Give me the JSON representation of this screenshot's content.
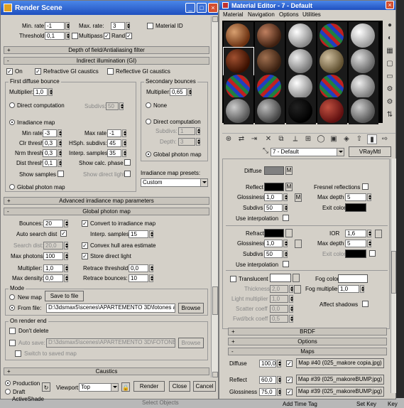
{
  "render_scene": {
    "title": "Render Scene",
    "top": {
      "min_rate_label": "Min. rate:",
      "min_rate": "-1",
      "max_rate_label": "Max. rate:",
      "max_rate": "3",
      "threshold_label": "Threshold:",
      "threshold": "0,1",
      "multipass_label": "Multipass",
      "rand_label": "Rand",
      "material_id_label": "Material ID"
    },
    "rollouts": {
      "dof": "Depth of field/Antialiasing filter",
      "indirect": "Indirect illumination (GI)",
      "adv_irr": "Advanced irradiance map parameters",
      "global_photon": "Global photon map",
      "caustics": "Caustics"
    },
    "gi": {
      "on_label": "On",
      "refr_label": "Refractive GI caustics",
      "refl_label": "Reflective GI caustics",
      "first_bounce": "First diffuse bounce",
      "multiplier_label": "Multiplier:",
      "multiplier": "1,0",
      "direct_comp": "Direct computation",
      "subdivs_label": "Subdivs:",
      "subdivs": "50",
      "irr_map": "Irradiance map",
      "min_rate_label": "Min rate:",
      "min_rate": "-3",
      "max_rate_label": "Max rate:",
      "max_rate": "-1",
      "clr_label": "Clr thresh:",
      "clr": "0,3",
      "hsph_label": "HSph. subdivs:",
      "hsph": "45",
      "nrm_label": "Nrm thresh:",
      "nrm": "0,3",
      "interp_label": "Interp. samples:",
      "interp": "35",
      "dist_label": "Dist thresh:",
      "dist": "0,1",
      "show_calc": "Show calc. phase",
      "show_samples": "Show samples",
      "show_direct": "Show direct light",
      "gpm": "Global photon map",
      "second_bounce": "Secondary bounces",
      "mult2_label": "Multiplier:",
      "mult2": "0,65",
      "none": "None",
      "direct2": "Direct computation",
      "subdivs2_label": "Subdivs:",
      "subdivs2": "1",
      "depth_label": "Depth:",
      "depth": "3",
      "gpm2": "Global photon map",
      "presets_label": "Irradiance map presets:",
      "preset": "Custom"
    },
    "gpm": {
      "bounces_label": "Bounces:",
      "bounces": "20",
      "convert": "Convert to irradiance map",
      "auto_search": "Auto search dist",
      "interp_label": "Interp. samples:",
      "interp": "15",
      "search_label": "Search dist:",
      "search": "20,0",
      "convex": "Convex hull area estimate",
      "max_ph_label": "Max photons:",
      "max_ph": "100",
      "store": "Store direct light",
      "mult_label": "Multiplier:",
      "mult": "1,0",
      "retr_th_label": "Retrace threshold:",
      "retr_th": "0,0",
      "max_dens_label": "Max density:",
      "max_dens": "0,0",
      "retr_b_label": "Retrace bounces:",
      "retr_b": "10"
    },
    "mode": {
      "title": "Mode",
      "new_map": "New map",
      "save": "Save to file",
      "from_file": "From file:",
      "path": "D:\\3dsmax5\\scenes\\APARTEMENTO 3D\\fotones ap",
      "browse": "Browse"
    },
    "on_end": {
      "title": "On render end",
      "dont_delete": "Don't delete",
      "auto_save": "Auto save:",
      "path": "D:\\3dsmax5\\scenes\\APARTEMENTO 3D\\FOTONES",
      "browse": "Browse",
      "switch": "Switch to saved map"
    },
    "bottom": {
      "production": "Production",
      "draft": "Draft",
      "activeshade": "ActiveShade",
      "viewport_label": "Viewport:",
      "viewport": "Top",
      "render": "Render",
      "close": "Close",
      "cancel": "Cancel"
    }
  },
  "material_editor": {
    "title": "Material Editor - 7 - Default",
    "menu": [
      "Material",
      "Navigation",
      "Options",
      "Utilities"
    ],
    "material_name": "7 - Default",
    "material_type": "VRayMtl",
    "basic": {
      "diffuse": "Diffuse",
      "m": "M",
      "reflect": "Reflect",
      "gloss_label": "Glossiness",
      "gloss": "1,0",
      "subdivs_label": "Subdivs",
      "subdivs": "50",
      "use_interp": "Use interpolation",
      "fresnel": "Fresnel reflections",
      "max_depth_label": "Max depth",
      "max_depth": "5",
      "exit_color": "Exit color",
      "refract": "Refract",
      "ior_label": "IOR",
      "ior": "1,6",
      "rgloss": "1,0",
      "rsubdivs": "50",
      "rmax_depth": "5",
      "translucent": "Translucent",
      "fog_color": "Fog color",
      "thickness_label": "Thickness",
      "thickness": "2,0",
      "fog_mult_label": "Fog multiplier",
      "fog_mult": "1,0",
      "light_mult_label": "Light multiplier",
      "light_mult": "1,0",
      "affect_shadows": "Affect shadows",
      "scatter_label": "Scatter coeff",
      "scatter": "0,0",
      "fwd_label": "Fwd/bck coeff",
      "fwd": "0,5"
    },
    "rollouts": {
      "brdf": "BRDF",
      "options": "Options",
      "maps": "Maps"
    },
    "maps": [
      {
        "name": "Diffuse",
        "amount": "100,0",
        "map": "Map #40 (025_makore copia.jpg)"
      },
      {
        "name": "Reflect",
        "amount": "60,0",
        "map": "Map #39 (025_makoreBUMP.jpg)"
      },
      {
        "name": "Glossiness",
        "amount": "75,0",
        "map": "Map #39 (025_makoreBUMP.jpg)"
      }
    ]
  },
  "taskbar": {
    "add_time_tag": "Add Time Tag",
    "set_key": "Set Key",
    "key": "Key",
    "fragment": "Select Objects"
  },
  "colors": {
    "title_blue": "#1f4fbf",
    "panel": "#d4d0c8",
    "diffuse_swatch": "#808080",
    "black": "#000000",
    "white": "#ffffff"
  }
}
